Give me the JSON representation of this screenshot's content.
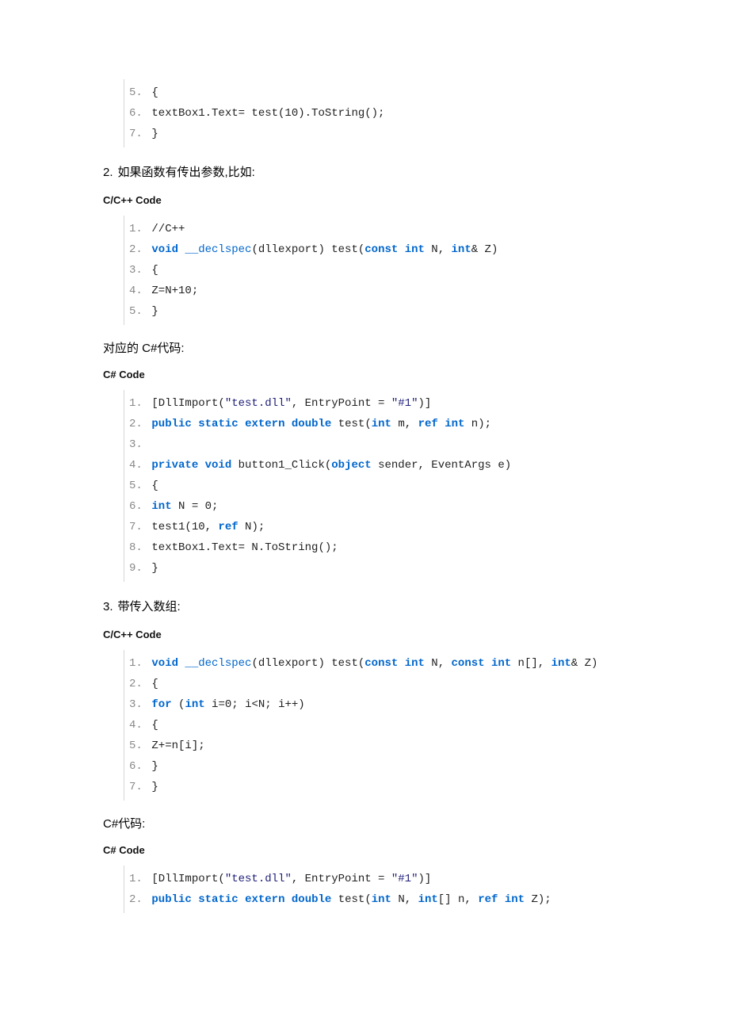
{
  "block1": {
    "lines": [
      {
        "n": "5.",
        "tokens": [
          {
            "c": "txt",
            "t": "{"
          }
        ]
      },
      {
        "n": "6.",
        "tokens": [
          {
            "c": "txt",
            "t": "textBox1.Text= test(10).ToString();"
          }
        ]
      },
      {
        "n": "7.",
        "tokens": [
          {
            "c": "txt",
            "t": "}"
          }
        ]
      }
    ]
  },
  "h2": {
    "num": "2.",
    "text": "如果函数有传出参数,比如:"
  },
  "label_cpp": "C/C++ Code",
  "block2": {
    "lines": [
      {
        "n": "1.",
        "tokens": [
          {
            "c": "txt",
            "t": "//C++"
          }
        ]
      },
      {
        "n": "2.",
        "tokens": [
          {
            "c": "kw",
            "t": "void"
          },
          {
            "c": "txt",
            "t": " "
          },
          {
            "c": "id",
            "t": "__declspec"
          },
          {
            "c": "txt",
            "t": "(dllexport) test("
          },
          {
            "c": "kw",
            "t": "const"
          },
          {
            "c": "txt",
            "t": " "
          },
          {
            "c": "kw",
            "t": "int"
          },
          {
            "c": "txt",
            "t": " N, "
          },
          {
            "c": "kw",
            "t": "int"
          },
          {
            "c": "txt",
            "t": "& Z)"
          }
        ]
      },
      {
        "n": "3.",
        "tokens": [
          {
            "c": "txt",
            "t": "{"
          }
        ]
      },
      {
        "n": "4.",
        "tokens": [
          {
            "c": "txt",
            "t": "Z=N+10;"
          }
        ]
      },
      {
        "n": "5.",
        "tokens": [
          {
            "c": "txt",
            "t": "}"
          }
        ]
      }
    ]
  },
  "p1": "对应的 C#代码:",
  "label_cs": "C# Code",
  "block3": {
    "lines": [
      {
        "n": "1.",
        "tokens": [
          {
            "c": "txt",
            "t": "[DllImport("
          },
          {
            "c": "str",
            "t": "\"test.dll\""
          },
          {
            "c": "txt",
            "t": ", EntryPoint = "
          },
          {
            "c": "str",
            "t": "\"#1\""
          },
          {
            "c": "txt",
            "t": ")]"
          }
        ]
      },
      {
        "n": "2.",
        "tokens": [
          {
            "c": "kw",
            "t": "public"
          },
          {
            "c": "txt",
            "t": " "
          },
          {
            "c": "kw",
            "t": "static"
          },
          {
            "c": "txt",
            "t": " "
          },
          {
            "c": "kw",
            "t": "extern"
          },
          {
            "c": "txt",
            "t": " "
          },
          {
            "c": "kw",
            "t": "double"
          },
          {
            "c": "txt",
            "t": " test("
          },
          {
            "c": "kw",
            "t": "int"
          },
          {
            "c": "txt",
            "t": " m, "
          },
          {
            "c": "kw",
            "t": "ref"
          },
          {
            "c": "txt",
            "t": " "
          },
          {
            "c": "kw",
            "t": "int"
          },
          {
            "c": "txt",
            "t": " n);"
          }
        ]
      },
      {
        "n": "3.",
        "tokens": [
          {
            "c": "txt",
            "t": ""
          }
        ]
      },
      {
        "n": "4.",
        "tokens": [
          {
            "c": "kw",
            "t": "private"
          },
          {
            "c": "txt",
            "t": " "
          },
          {
            "c": "kw",
            "t": "void"
          },
          {
            "c": "txt",
            "t": " button1_Click("
          },
          {
            "c": "kw",
            "t": "object"
          },
          {
            "c": "txt",
            "t": " sender, EventArgs e)"
          }
        ]
      },
      {
        "n": "5.",
        "tokens": [
          {
            "c": "txt",
            "t": "{"
          }
        ]
      },
      {
        "n": "6.",
        "tokens": [
          {
            "c": "kw",
            "t": "int"
          },
          {
            "c": "txt",
            "t": " N = 0;"
          }
        ]
      },
      {
        "n": "7.",
        "tokens": [
          {
            "c": "txt",
            "t": "test1(10, "
          },
          {
            "c": "kw",
            "t": "ref"
          },
          {
            "c": "txt",
            "t": " N);"
          }
        ]
      },
      {
        "n": "8.",
        "tokens": [
          {
            "c": "txt",
            "t": "textBox1.Text= N.ToString();"
          }
        ]
      },
      {
        "n": "9.",
        "tokens": [
          {
            "c": "txt",
            "t": "}"
          }
        ]
      }
    ]
  },
  "h3": {
    "num": "3.",
    "text": "带传入数组:"
  },
  "block4": {
    "lines": [
      {
        "n": "1.",
        "tokens": [
          {
            "c": "kw",
            "t": "void"
          },
          {
            "c": "txt",
            "t": " "
          },
          {
            "c": "id",
            "t": "__declspec"
          },
          {
            "c": "txt",
            "t": "(dllexport) test("
          },
          {
            "c": "kw",
            "t": "const"
          },
          {
            "c": "txt",
            "t": " "
          },
          {
            "c": "kw",
            "t": "int"
          },
          {
            "c": "txt",
            "t": " N, "
          },
          {
            "c": "kw",
            "t": "const"
          },
          {
            "c": "txt",
            "t": " "
          },
          {
            "c": "kw",
            "t": "int"
          },
          {
            "c": "txt",
            "t": " n[], "
          },
          {
            "c": "kw",
            "t": "int"
          },
          {
            "c": "txt",
            "t": "& Z)"
          }
        ]
      },
      {
        "n": "2.",
        "tokens": [
          {
            "c": "txt",
            "t": "{"
          }
        ]
      },
      {
        "n": "3.",
        "tokens": [
          {
            "c": "kw",
            "t": "for"
          },
          {
            "c": "txt",
            "t": " ("
          },
          {
            "c": "kw",
            "t": "int"
          },
          {
            "c": "txt",
            "t": " i=0; i<N; i++)"
          }
        ]
      },
      {
        "n": "4.",
        "tokens": [
          {
            "c": "txt",
            "t": "{"
          }
        ]
      },
      {
        "n": "5.",
        "tokens": [
          {
            "c": "txt",
            "t": "Z+=n[i];"
          }
        ]
      },
      {
        "n": "6.",
        "tokens": [
          {
            "c": "txt",
            "t": "}"
          }
        ]
      },
      {
        "n": "7.",
        "tokens": [
          {
            "c": "txt",
            "t": "}"
          }
        ]
      }
    ]
  },
  "p2": "C#代码:",
  "block5": {
    "lines": [
      {
        "n": "1.",
        "tokens": [
          {
            "c": "txt",
            "t": "[DllImport("
          },
          {
            "c": "str",
            "t": "\"test.dll\""
          },
          {
            "c": "txt",
            "t": ", EntryPoint = "
          },
          {
            "c": "str",
            "t": "\"#1\""
          },
          {
            "c": "txt",
            "t": ")]"
          }
        ]
      },
      {
        "n": "2.",
        "tokens": [
          {
            "c": "kw",
            "t": "public"
          },
          {
            "c": "txt",
            "t": " "
          },
          {
            "c": "kw",
            "t": "static"
          },
          {
            "c": "txt",
            "t": " "
          },
          {
            "c": "kw",
            "t": "extern"
          },
          {
            "c": "txt",
            "t": " "
          },
          {
            "c": "kw",
            "t": "double"
          },
          {
            "c": "txt",
            "t": " test("
          },
          {
            "c": "kw",
            "t": "int"
          },
          {
            "c": "txt",
            "t": " N, "
          },
          {
            "c": "kw",
            "t": "int"
          },
          {
            "c": "txt",
            "t": "[] n, "
          },
          {
            "c": "kw",
            "t": "ref"
          },
          {
            "c": "txt",
            "t": " "
          },
          {
            "c": "kw",
            "t": "int"
          },
          {
            "c": "txt",
            "t": " Z);"
          }
        ]
      }
    ]
  }
}
